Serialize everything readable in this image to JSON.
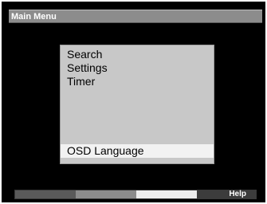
{
  "title_bar": {
    "title": "Main Menu"
  },
  "menu": {
    "items": [
      {
        "label": "Search"
      },
      {
        "label": "Settings"
      },
      {
        "label": "Timer"
      }
    ],
    "selected_item": {
      "label": "OSD Language"
    }
  },
  "color_keys": {
    "red": {
      "color": "#5a5a5a",
      "label": ""
    },
    "green": {
      "color": "#8c8c8c",
      "label": ""
    },
    "yellow": {
      "color": "#ededed",
      "label": ""
    },
    "blue": {
      "color": "#3c3c3c",
      "label": "Help"
    }
  }
}
